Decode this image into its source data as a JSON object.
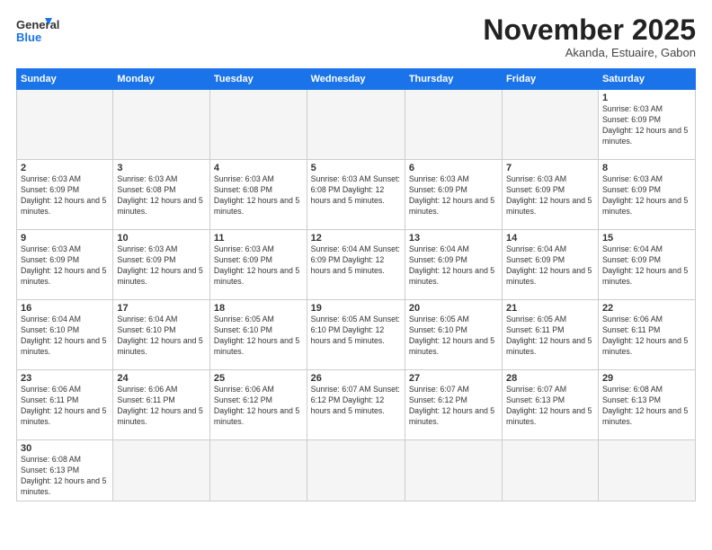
{
  "header": {
    "logo_general": "General",
    "logo_blue": "Blue",
    "title": "November 2025",
    "subtitle": "Akanda, Estuaire, Gabon"
  },
  "weekdays": [
    "Sunday",
    "Monday",
    "Tuesday",
    "Wednesday",
    "Thursday",
    "Friday",
    "Saturday"
  ],
  "weeks": [
    [
      {
        "day": "",
        "info": ""
      },
      {
        "day": "",
        "info": ""
      },
      {
        "day": "",
        "info": ""
      },
      {
        "day": "",
        "info": ""
      },
      {
        "day": "",
        "info": ""
      },
      {
        "day": "",
        "info": ""
      },
      {
        "day": "1",
        "info": "Sunrise: 6:03 AM\nSunset: 6:09 PM\nDaylight: 12 hours and 5 minutes."
      }
    ],
    [
      {
        "day": "2",
        "info": "Sunrise: 6:03 AM\nSunset: 6:09 PM\nDaylight: 12 hours and 5 minutes."
      },
      {
        "day": "3",
        "info": "Sunrise: 6:03 AM\nSunset: 6:08 PM\nDaylight: 12 hours and 5 minutes."
      },
      {
        "day": "4",
        "info": "Sunrise: 6:03 AM\nSunset: 6:08 PM\nDaylight: 12 hours and 5 minutes."
      },
      {
        "day": "5",
        "info": "Sunrise: 6:03 AM\nSunset: 6:08 PM\nDaylight: 12 hours and 5 minutes."
      },
      {
        "day": "6",
        "info": "Sunrise: 6:03 AM\nSunset: 6:09 PM\nDaylight: 12 hours and 5 minutes."
      },
      {
        "day": "7",
        "info": "Sunrise: 6:03 AM\nSunset: 6:09 PM\nDaylight: 12 hours and 5 minutes."
      },
      {
        "day": "8",
        "info": "Sunrise: 6:03 AM\nSunset: 6:09 PM\nDaylight: 12 hours and 5 minutes."
      }
    ],
    [
      {
        "day": "9",
        "info": "Sunrise: 6:03 AM\nSunset: 6:09 PM\nDaylight: 12 hours and 5 minutes."
      },
      {
        "day": "10",
        "info": "Sunrise: 6:03 AM\nSunset: 6:09 PM\nDaylight: 12 hours and 5 minutes."
      },
      {
        "day": "11",
        "info": "Sunrise: 6:03 AM\nSunset: 6:09 PM\nDaylight: 12 hours and 5 minutes."
      },
      {
        "day": "12",
        "info": "Sunrise: 6:04 AM\nSunset: 6:09 PM\nDaylight: 12 hours and 5 minutes."
      },
      {
        "day": "13",
        "info": "Sunrise: 6:04 AM\nSunset: 6:09 PM\nDaylight: 12 hours and 5 minutes."
      },
      {
        "day": "14",
        "info": "Sunrise: 6:04 AM\nSunset: 6:09 PM\nDaylight: 12 hours and 5 minutes."
      },
      {
        "day": "15",
        "info": "Sunrise: 6:04 AM\nSunset: 6:09 PM\nDaylight: 12 hours and 5 minutes."
      }
    ],
    [
      {
        "day": "16",
        "info": "Sunrise: 6:04 AM\nSunset: 6:10 PM\nDaylight: 12 hours and 5 minutes."
      },
      {
        "day": "17",
        "info": "Sunrise: 6:04 AM\nSunset: 6:10 PM\nDaylight: 12 hours and 5 minutes."
      },
      {
        "day": "18",
        "info": "Sunrise: 6:05 AM\nSunset: 6:10 PM\nDaylight: 12 hours and 5 minutes."
      },
      {
        "day": "19",
        "info": "Sunrise: 6:05 AM\nSunset: 6:10 PM\nDaylight: 12 hours and 5 minutes."
      },
      {
        "day": "20",
        "info": "Sunrise: 6:05 AM\nSunset: 6:10 PM\nDaylight: 12 hours and 5 minutes."
      },
      {
        "day": "21",
        "info": "Sunrise: 6:05 AM\nSunset: 6:11 PM\nDaylight: 12 hours and 5 minutes."
      },
      {
        "day": "22",
        "info": "Sunrise: 6:06 AM\nSunset: 6:11 PM\nDaylight: 12 hours and 5 minutes."
      }
    ],
    [
      {
        "day": "23",
        "info": "Sunrise: 6:06 AM\nSunset: 6:11 PM\nDaylight: 12 hours and 5 minutes."
      },
      {
        "day": "24",
        "info": "Sunrise: 6:06 AM\nSunset: 6:11 PM\nDaylight: 12 hours and 5 minutes."
      },
      {
        "day": "25",
        "info": "Sunrise: 6:06 AM\nSunset: 6:12 PM\nDaylight: 12 hours and 5 minutes."
      },
      {
        "day": "26",
        "info": "Sunrise: 6:07 AM\nSunset: 6:12 PM\nDaylight: 12 hours and 5 minutes."
      },
      {
        "day": "27",
        "info": "Sunrise: 6:07 AM\nSunset: 6:12 PM\nDaylight: 12 hours and 5 minutes."
      },
      {
        "day": "28",
        "info": "Sunrise: 6:07 AM\nSunset: 6:13 PM\nDaylight: 12 hours and 5 minutes."
      },
      {
        "day": "29",
        "info": "Sunrise: 6:08 AM\nSunset: 6:13 PM\nDaylight: 12 hours and 5 minutes."
      }
    ],
    [
      {
        "day": "30",
        "info": "Sunrise: 6:08 AM\nSunset: 6:13 PM\nDaylight: 12 hours and 5 minutes."
      },
      {
        "day": "",
        "info": ""
      },
      {
        "day": "",
        "info": ""
      },
      {
        "day": "",
        "info": ""
      },
      {
        "day": "",
        "info": ""
      },
      {
        "day": "",
        "info": ""
      },
      {
        "day": "",
        "info": ""
      }
    ]
  ]
}
